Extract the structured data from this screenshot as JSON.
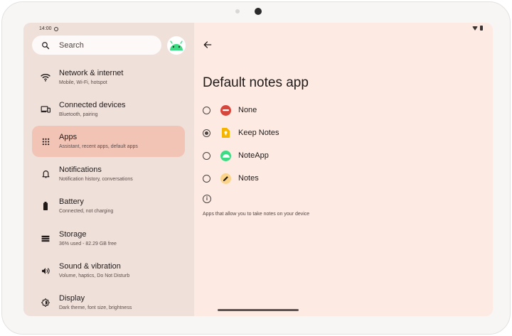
{
  "status_bar": {
    "time": "14:00"
  },
  "search": {
    "placeholder": "Search"
  },
  "menu": [
    {
      "title": "Network & internet",
      "subtitle": "Mobile, Wi-Fi, hotspot",
      "icon": "wifi-icon"
    },
    {
      "title": "Connected devices",
      "subtitle": "Bluetooth, pairing",
      "icon": "devices-icon"
    },
    {
      "title": "Apps",
      "subtitle": "Assistant, recent apps, default apps",
      "icon": "apps-grid-icon",
      "active": true
    },
    {
      "title": "Notifications",
      "subtitle": "Notification history, conversations",
      "icon": "bell-icon"
    },
    {
      "title": "Battery",
      "subtitle": "Connected, not charging",
      "icon": "battery-icon"
    },
    {
      "title": "Storage",
      "subtitle": "36% used - 82.29 GB free",
      "icon": "storage-icon"
    },
    {
      "title": "Sound & vibration",
      "subtitle": "Volume, haptics, Do Not Disturb",
      "icon": "speaker-icon"
    },
    {
      "title": "Display",
      "subtitle": "Dark theme, font size, brightness",
      "icon": "display-icon"
    }
  ],
  "page": {
    "title": "Default notes app",
    "options": [
      {
        "label": "None",
        "selected": false,
        "icon": "none-icon",
        "color": "#d8453a"
      },
      {
        "label": "Keep Notes",
        "selected": true,
        "icon": "keep-notes-icon",
        "color": "#f5b400"
      },
      {
        "label": "NoteApp",
        "selected": false,
        "icon": "android-icon",
        "color": "#3ddc84"
      },
      {
        "label": "Notes",
        "selected": false,
        "icon": "pencil-icon",
        "color": "#fbd38a"
      }
    ],
    "footer": "Apps that allow you to take notes on your device"
  },
  "colors": {
    "active_item": "#f1c4b6",
    "panel_left": "#efe0da",
    "panel_right": "#fdebe3"
  }
}
